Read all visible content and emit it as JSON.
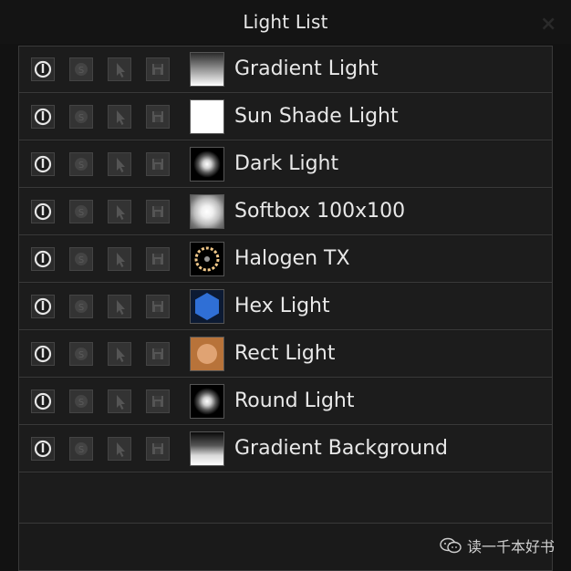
{
  "window": {
    "title": "Light List",
    "close_glyph": "×"
  },
  "lights": [
    {
      "name": "Gradient Light",
      "thumb": "gradient"
    },
    {
      "name": "Sun Shade Light",
      "thumb": "sun"
    },
    {
      "name": "Dark Light",
      "thumb": "dark"
    },
    {
      "name": "Softbox 100x100",
      "thumb": "softbox"
    },
    {
      "name": "Halogen TX",
      "thumb": "halogen"
    },
    {
      "name": "Hex Light",
      "thumb": "hex"
    },
    {
      "name": "Rect Light",
      "thumb": "rect"
    },
    {
      "name": "Round Light",
      "thumb": "round"
    },
    {
      "name": "Gradient Background",
      "thumb": "gradbg"
    }
  ],
  "row_buttons": {
    "power_icon": "power-icon",
    "solo_icon": "solo-icon",
    "select_icon": "cursor-icon",
    "save_icon": "save-icon"
  },
  "colors": {
    "hex_light": "#2f6fd6",
    "rect_light": "#e0a373",
    "halogen": "#f2c98a"
  },
  "watermark": {
    "text": "读一千本好书"
  }
}
